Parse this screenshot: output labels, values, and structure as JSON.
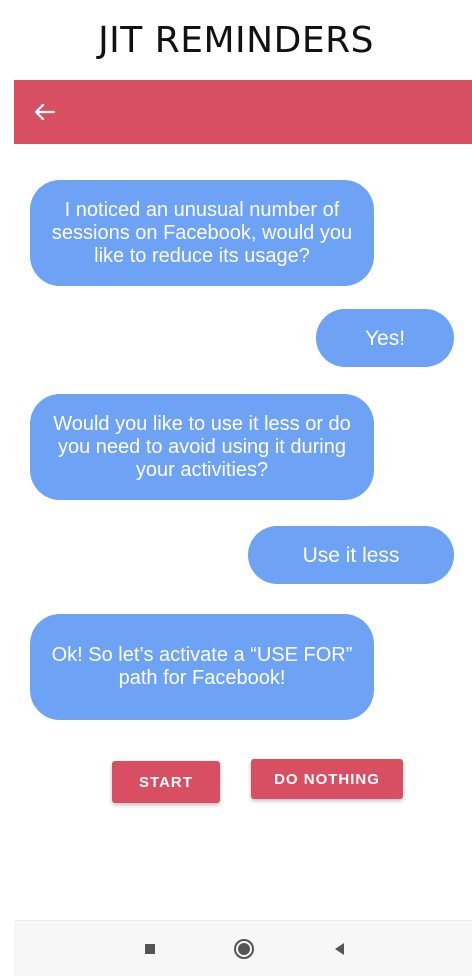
{
  "header": {
    "title": "JIT REMINDERS"
  },
  "appbar": {
    "back_icon": "arrow-left-icon",
    "color": "#d84f63"
  },
  "chat": {
    "messages": [
      {
        "from": "bot",
        "text": "I noticed an unusual number of sessions on Facebook, would you like to reduce its usage?"
      },
      {
        "from": "user",
        "text": "Yes!"
      },
      {
        "from": "bot",
        "text": "Would you like to use it less or do you need to avoid using it during your activities?"
      },
      {
        "from": "user",
        "text": "Use it less"
      },
      {
        "from": "bot",
        "text": "Ok! So let’s activate a “USE FOR” path for Facebook!"
      }
    ],
    "bubble_color": "#6ea2f5"
  },
  "actions": {
    "start_label": "START",
    "do_nothing_label": "DO NOTHING"
  },
  "navbar": {
    "icons": [
      "recents-square-icon",
      "home-circle-icon",
      "back-triangle-icon"
    ]
  }
}
